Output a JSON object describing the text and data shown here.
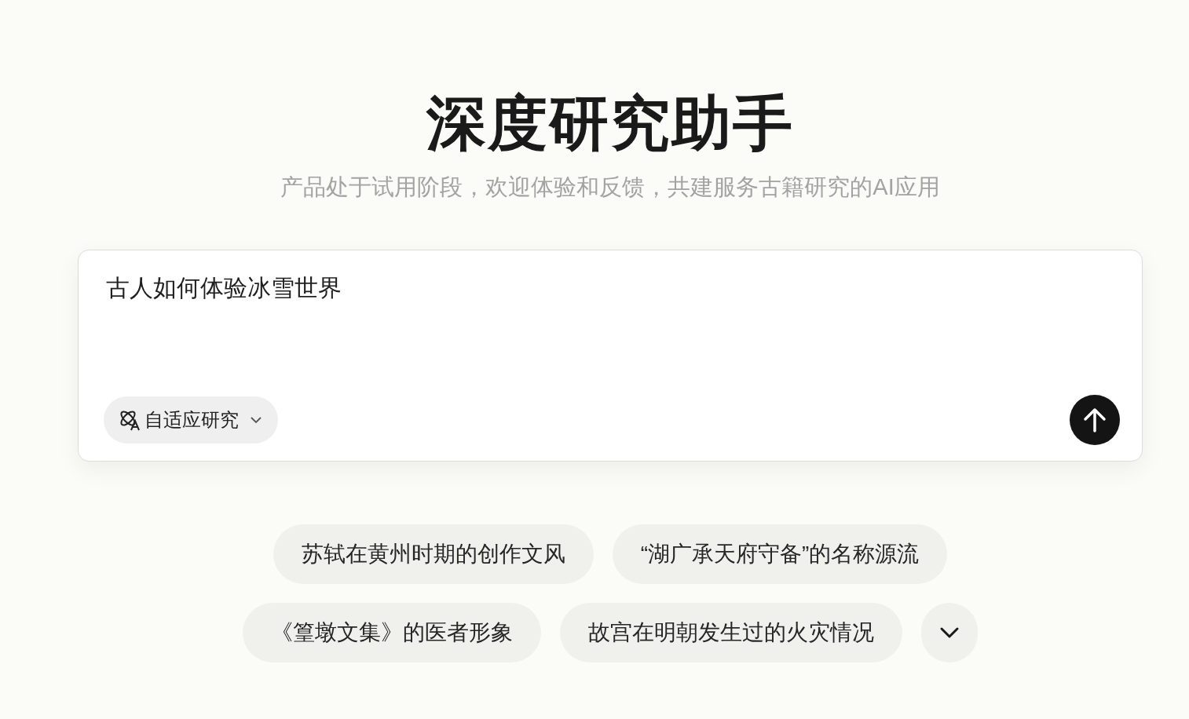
{
  "title": "深度研究助手",
  "subtitle": "产品处于试用阶段，欢迎体验和反馈，共建服务古籍研究的AI应用",
  "query": {
    "value": "古人如何体验冰雪世界"
  },
  "mode_button": {
    "label": "自适应研究"
  },
  "suggestions": [
    {
      "label": "苏轼在黄州时期的创作文风"
    },
    {
      "label": "“湖广承天府守备”的名称源流"
    },
    {
      "label": "《篁墩文集》的医者形象"
    },
    {
      "label": "故宫在明朝发生过的火灾情况"
    }
  ]
}
